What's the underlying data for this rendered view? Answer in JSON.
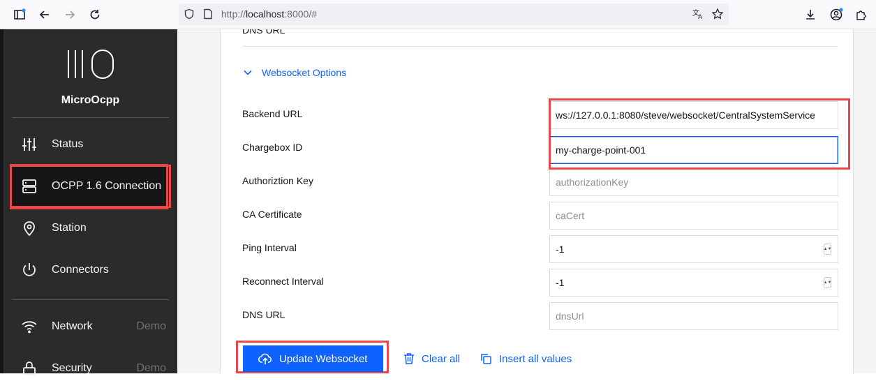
{
  "browser": {
    "url_prefix": "http://",
    "url_host": "localhost",
    "url_suffix": ":8000/#"
  },
  "sidebar": {
    "app_name": "MicroOcpp",
    "items": [
      {
        "label": "Status",
        "icon": "sliders-icon"
      },
      {
        "label": "OCPP 1.6 Connection",
        "icon": "server-icon"
      },
      {
        "label": "Station",
        "icon": "location-pin-icon"
      },
      {
        "label": "Connectors",
        "icon": "power-icon"
      },
      {
        "label": "Network",
        "icon": "wifi-icon",
        "aux": "Demo"
      },
      {
        "label": "Security",
        "icon": "lock-icon",
        "aux": "Demo"
      }
    ]
  },
  "main": {
    "prev_field_label": "DNS URL",
    "section_title": "Websocket Options",
    "fields": [
      {
        "label": "Backend URL",
        "value": "ws://127.0.0.1:8080/steve/websocket/CentralSystemService",
        "placeholder": ""
      },
      {
        "label": "Chargebox ID",
        "value": "my-charge-point-001",
        "placeholder": ""
      },
      {
        "label": "Authoriztion Key",
        "value": "",
        "placeholder": "authorizationKey"
      },
      {
        "label": "CA Certificate",
        "value": "",
        "placeholder": "caCert"
      },
      {
        "label": "Ping Interval",
        "value": "-1",
        "placeholder": ""
      },
      {
        "label": "Reconnect Interval",
        "value": "-1",
        "placeholder": ""
      },
      {
        "label": "DNS URL",
        "value": "",
        "placeholder": "dnsUrl"
      }
    ],
    "buttons": {
      "update": "Update Websocket",
      "clear": "Clear all",
      "insert": "Insert all values"
    }
  },
  "colors": {
    "accent": "#0f62fe",
    "highlight": "#e8474c",
    "sidebar_bg": "#2b2b2b"
  }
}
